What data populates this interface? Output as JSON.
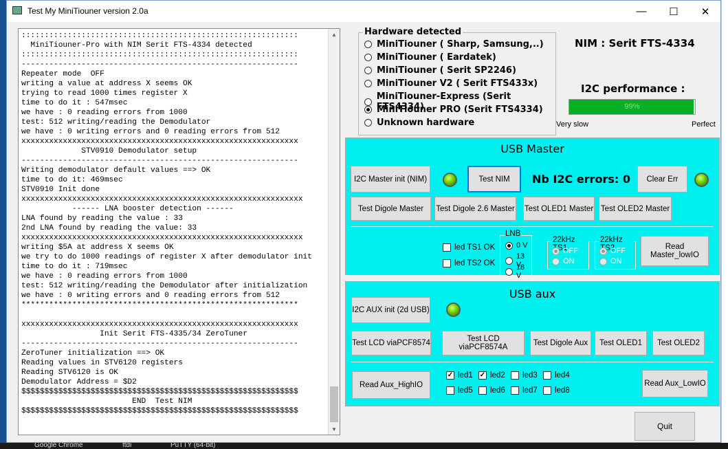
{
  "window": {
    "title": "Test My MiniTiouner version 2.0a",
    "minimize": "—",
    "maximize": "☐",
    "close": "✕"
  },
  "log": {
    "text": "::::::::::::::::::::::::::::::::::::::::::::::::::::::::::::\n  MiniTiouner-Pro with NIM Serit FTS-4334 detected\n::::::::::::::::::::::::::::::::::::::::::::::::::::::::::::\n------------------------------------------------------------\nRepeater mode  OFF\nwriting a value at address X seems OK\ntrying to read 1000 times register X\ntime to do it : 547msec\nwe have : 0 reading errors from 1000\ntest: 512 writing/reading the Demodulator\nwe have : 0 writing errors and 0 reading errors from 512\nxxxxxxxxxxxxxxxxxxxxxxxxxxxxxxxxxxxxxxxxxxxxxxxxxxxxxxxxxxxx\n             STV0910 Demodulator setup\n------------------------------------------------------------\nWriting demodulator default values ==> OK\ntime to do it: 469msec\nSTV0910 Init done\nxxxxxxxxxxxxxxxxxxxxxxxxxxxxxxxxxxxxxxxxxxxxxxxxxxxxxxxxxxxxx\n           ------ LNA booster detection ------\nLNA found by reading the value : 33\n2nd LNA found by reading the value: 33\nxxxxxxxxxxxxxxxxxxxxxxxxxxxxxxxxxxxxxxxxxxxxxxxxxxxxxxxxxxxxx\nwriting $5A at address X seems OK\nwe try to do 1000 readings of register X after demodulator init\ntime to do it : 719msec\nwe have : 0 reading errors from 1000\ntest: 512 writing/reading the Demodulator after initialization\nwe have : 0 writing errors and 0 reading errors from 512\n************************************************************\n\nxxxxxxxxxxxxxxxxxxxxxxxxxxxxxxxxxxxxxxxxxxxxxxxxxxxxxxxxxxxx\n                 Init Serit FTS-4335/34 ZeroTuner\n------------------------------------------------------------\nZeroTuner initialization ==> OK\nReading values in STV6120 registers\nReading STV6120 is OK\nDemodulator Address = $D2\n$$$$$$$$$$$$$$$$$$$$$$$$$$$$$$$$$$$$$$$$$$$$$$$$$$$$$$$$$$$$\n                        END  Test NIM\n$$$$$$$$$$$$$$$$$$$$$$$$$$$$$$$$$$$$$$$$$$$$$$$$$$$$$$$$$$$$"
  },
  "hardware": {
    "legend": "Hardware detected",
    "options": [
      {
        "label": "MiniTiouner ( Sharp, Samsung,..)",
        "selected": false
      },
      {
        "label": "MiniTiouner ( Eardatek)",
        "selected": false
      },
      {
        "label": "MiniTiouner ( Serit SP2246)",
        "selected": false
      },
      {
        "label": "MiniTiouner V2 ( Serit FTS433x)",
        "selected": false
      },
      {
        "label": "MiniTiouner-Express (Serit FTS4334)",
        "selected": false
      },
      {
        "label": "MiniTiouner PRO  (Serit FTS4334)",
        "selected": true
      },
      {
        "label": "Unknown hardware",
        "selected": false
      }
    ]
  },
  "nim": {
    "label": "NIM :  Serit FTS-4334"
  },
  "performance": {
    "title": "I2C performance :",
    "value_text": "99%",
    "value": 0.99,
    "min_label": "Very slow",
    "max_label": "Perfect",
    "color": "#06b025"
  },
  "usb_master": {
    "title": "USB Master",
    "i2c_init": "I2C Master init (NIM)",
    "test_nim": "Test NIM",
    "nb_errors": "Nb I2C errors:  0",
    "clear_err": "Clear Err",
    "test_digole": "Test Digole Master",
    "test_digole26": "Test Digole 2.6 Master",
    "test_oled1": "Test OLED1 Master",
    "test_oled2": "Test OLED2 Master",
    "led_ts1": "led TS1 OK",
    "led_ts2": "led TS2 OK",
    "lnb": {
      "legend": "LNB",
      "options": [
        "0 V",
        "13 V",
        "18 V"
      ],
      "selected": "0 V"
    },
    "ts1": {
      "legend": "22kHz TS1",
      "options": [
        "OFF",
        "ON"
      ],
      "selected": "OFF"
    },
    "ts2": {
      "legend": "22kHz TS2",
      "options": [
        "OFF",
        "ON"
      ],
      "selected": "OFF"
    },
    "read_lowio": "Read Master_lowIO"
  },
  "usb_aux": {
    "title": "USB aux",
    "i2c_init": "I2C AUX init (2d USB)",
    "test_lcd": "Test LCD viaPCF8574",
    "test_lcd_a": "Test LCD viaPCF8574A",
    "test_digole": "Test Digole Aux",
    "test_oled1": "Test OLED1",
    "test_oled2": "Test OLED2",
    "read_highio": "Read Aux_HighIO",
    "read_lowio": "Read Aux_LowIO",
    "leds": [
      {
        "label": "led1",
        "checked": true
      },
      {
        "label": "led2",
        "checked": true
      },
      {
        "label": "led3",
        "checked": false
      },
      {
        "label": "led4",
        "checked": false
      },
      {
        "label": "led5",
        "checked": false
      },
      {
        "label": "led6",
        "checked": false
      },
      {
        "label": "led7",
        "checked": false
      },
      {
        "label": "led8",
        "checked": false
      }
    ]
  },
  "quit": "Quit",
  "colors": {
    "panel": "#00f0f0",
    "led_on": "#6bd000",
    "titlebar": "#ffffff"
  },
  "taskbar": {
    "items": [
      "Google Chrome",
      "ftdi",
      "PuTTY (64-bit)"
    ]
  }
}
